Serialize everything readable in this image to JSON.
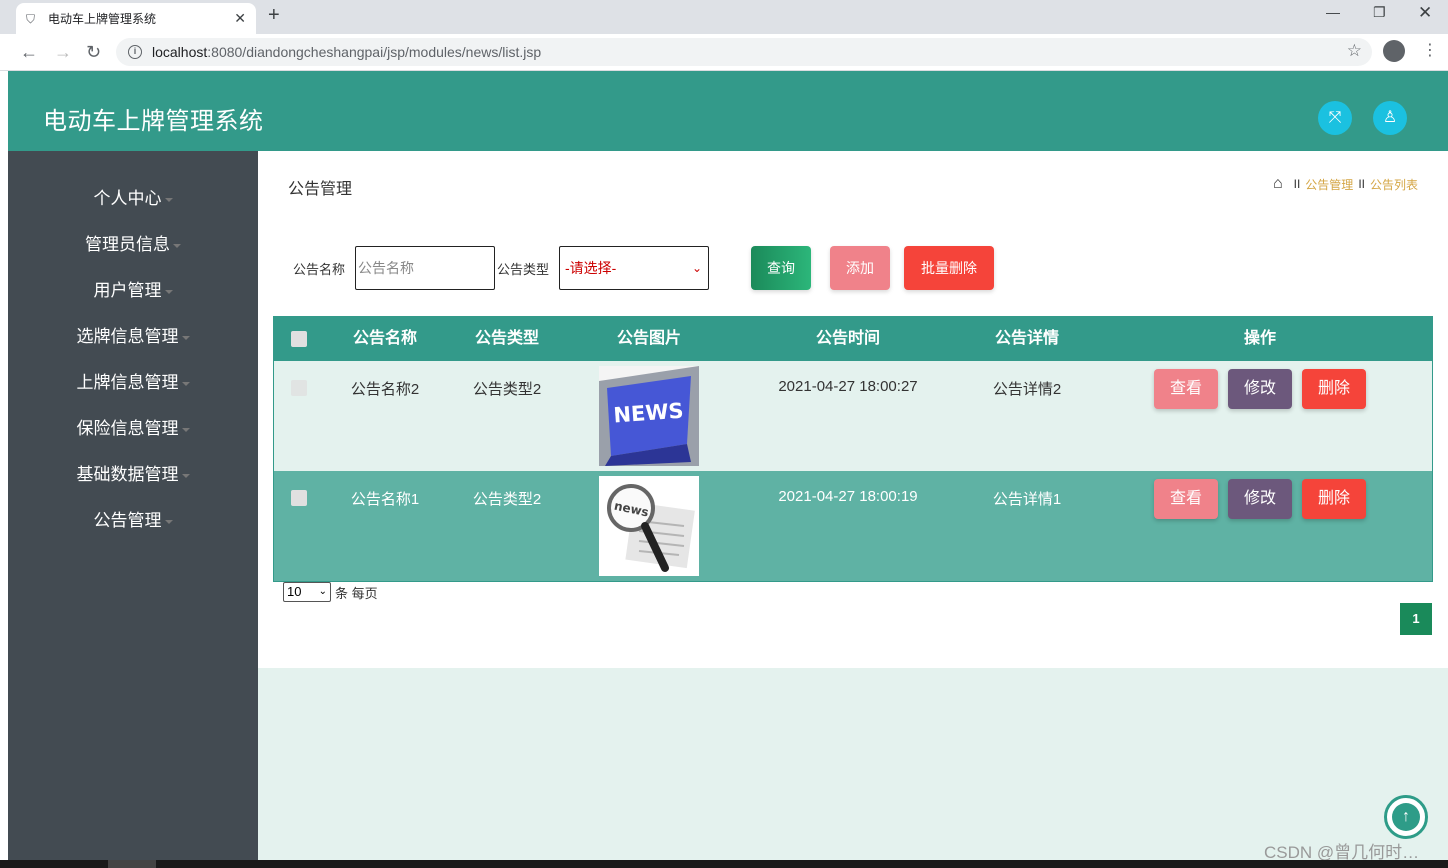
{
  "browser": {
    "tab_title": "电动车上牌管理系统",
    "url_host": "localhost",
    "url_rest": ":8080/diandongcheshangpai/jsp/modules/news/list.jsp"
  },
  "header": {
    "title": "电动车上牌管理系统"
  },
  "sidebar": {
    "items": [
      {
        "label": "个人中心"
      },
      {
        "label": "管理员信息"
      },
      {
        "label": "用户管理"
      },
      {
        "label": "选牌信息管理"
      },
      {
        "label": "上牌信息管理"
      },
      {
        "label": "保险信息管理"
      },
      {
        "label": "基础数据管理"
      },
      {
        "label": "公告管理"
      }
    ]
  },
  "page": {
    "title": "公告管理",
    "breadcrumb": [
      "公告管理",
      "公告列表"
    ],
    "breadcrumb_sep": "II"
  },
  "search": {
    "name_label": "公告名称",
    "name_placeholder": "公告名称",
    "type_label": "公告类型",
    "type_selected": "-请选择-",
    "query_label": "查询",
    "add_label": "添加",
    "batch_delete_label": "批量删除"
  },
  "table": {
    "headers": [
      "公告名称",
      "公告类型",
      "公告图片",
      "公告时间",
      "公告详情",
      "操作"
    ],
    "rows": [
      {
        "name": "公告名称2",
        "type": "公告类型2",
        "image": "news-keyboard-image",
        "time": "2021-04-27 18:00:27",
        "detail": "公告详情2"
      },
      {
        "name": "公告名称1",
        "type": "公告类型2",
        "image": "news-magnifier-image",
        "time": "2021-04-27 18:00:19",
        "detail": "公告详情1"
      }
    ],
    "view_label": "查看",
    "edit_label": "修改",
    "delete_label": "删除"
  },
  "pagination": {
    "page_size": "10",
    "per_page_text": "条 每页",
    "current_page": "1"
  },
  "watermark": "CSDN @曾几何时…",
  "colors": {
    "header": "#339a8a",
    "sidebar": "#434b52",
    "row_light": "#e4f2ee",
    "row_dark": "#5fb2a4",
    "view": "#f0828a",
    "edit": "#6c587c",
    "delete": "#f5443a",
    "query_from": "#1b8a5a",
    "query_to": "#2cb67a",
    "breadcrumb_link": "#d4a645"
  }
}
